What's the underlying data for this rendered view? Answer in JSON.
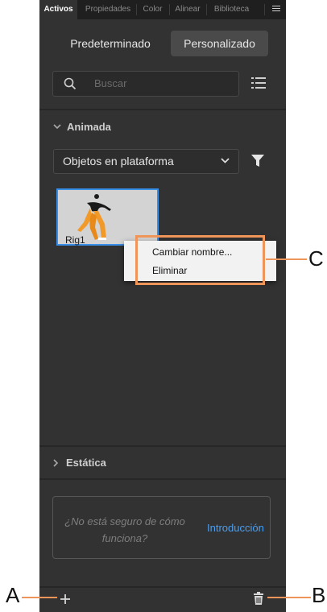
{
  "tabs": [
    {
      "label": "Activos",
      "active": true
    },
    {
      "label": "Propiedades",
      "active": false
    },
    {
      "label": "Color",
      "active": false
    },
    {
      "label": "Alinear",
      "active": false
    },
    {
      "label": "Biblioteca",
      "active": false
    }
  ],
  "segmented": {
    "default_label": "Predeterminado",
    "custom_label": "Personalizado",
    "selected": "Personalizado"
  },
  "search": {
    "placeholder": "Buscar"
  },
  "sections": {
    "animated": "Animada",
    "static": "Estática"
  },
  "filter_dropdown": {
    "value": "Objetos en plataforma"
  },
  "asset": {
    "name": "Rig1"
  },
  "context_menu": {
    "items": [
      "Cambiar nombre...",
      "Eliminar"
    ]
  },
  "intro": {
    "question": "¿No está seguro de cómo funciona?",
    "link": "Introducción"
  },
  "callouts": {
    "a": "A",
    "b": "B",
    "c": "C"
  },
  "colors": {
    "panel": "#323232",
    "accent": "#3a8fe8",
    "callout": "#f0955a",
    "link": "#4b9ff0"
  },
  "icons": [
    "search-icon",
    "list-view-icon",
    "filter-icon",
    "chevron-down-icon",
    "chevron-right-icon",
    "add-icon",
    "trash-icon",
    "panel-menu-icon"
  ]
}
